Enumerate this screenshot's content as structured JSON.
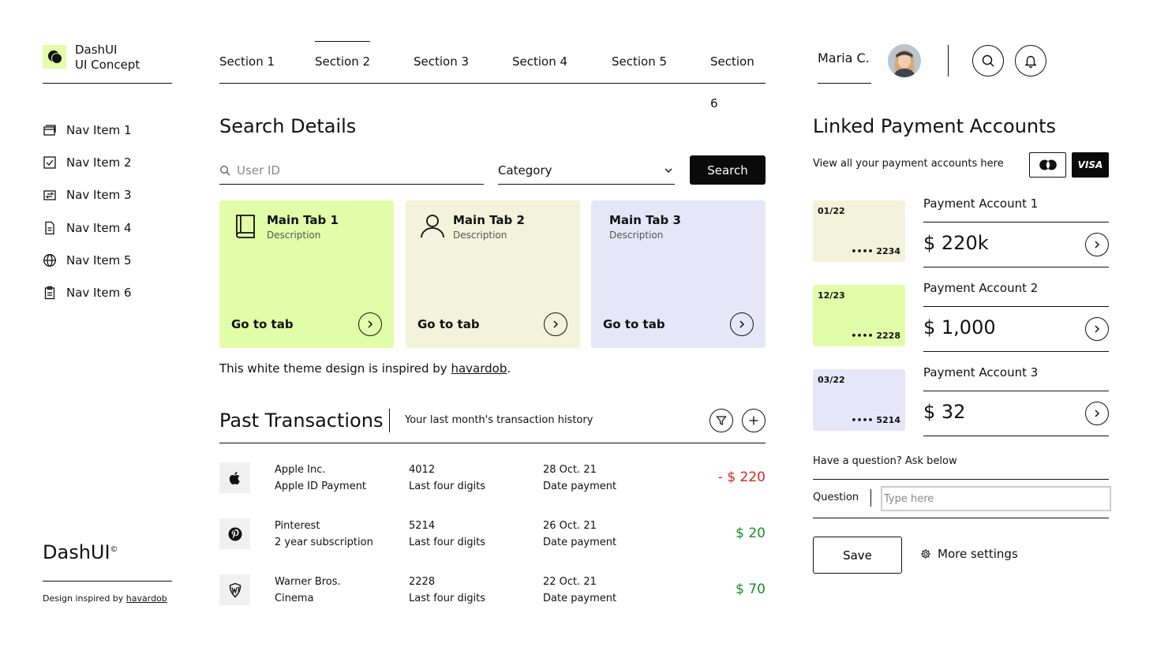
{
  "brand": {
    "name_line1": "DashUI",
    "name_line2": "UI Concept"
  },
  "sidebar": {
    "items": [
      {
        "label": "Nav Item 1",
        "icon": "cards-icon"
      },
      {
        "label": "Nav Item 2",
        "icon": "checkbox-icon"
      },
      {
        "label": "Nav Item 3",
        "icon": "transfer-icon"
      },
      {
        "label": "Nav Item 4",
        "icon": "document-icon"
      },
      {
        "label": "Nav Item 5",
        "icon": "globe-icon"
      },
      {
        "label": "Nav Item 6",
        "icon": "clipboard-icon"
      }
    ],
    "footer_logo": "DashUI",
    "footer_logo_mark": "©",
    "footer_note_prefix": "Design inspired by ",
    "footer_note_link": "havardob"
  },
  "tabs": {
    "items": [
      "Section 1",
      "Section 2",
      "Section 3",
      "Section 4",
      "Section 5",
      "Section 6"
    ],
    "active_index": 1
  },
  "user": {
    "name": "Maria C."
  },
  "search": {
    "title": "Search Details",
    "placeholder": "User ID",
    "category_label": "Category",
    "button_label": "Search"
  },
  "cards": [
    {
      "title": "Main Tab 1",
      "description": "Description",
      "action": "Go to tab",
      "icon": "book-icon",
      "color": "#e2fda8"
    },
    {
      "title": "Main Tab 2",
      "description": "Description",
      "action": "Go to tab",
      "icon": "user-icon",
      "color": "#f2f3da"
    },
    {
      "title": "Main Tab 3",
      "description": "Description",
      "action": "Go to tab",
      "icon": "",
      "color": "#e6e6f8"
    }
  ],
  "inspired": {
    "prefix": "This white theme design is inspired by ",
    "link": "havardob",
    "suffix": "."
  },
  "transactions": {
    "title": "Past Transactions",
    "subtitle": "Your last month's transaction history",
    "rows": [
      {
        "logo": "apple-icon",
        "company": "Apple Inc.",
        "detail": "Apple ID Payment",
        "digits": "4012",
        "digits_label": "Last four digits",
        "date": "28 Oct. 21",
        "date_label": "Date payment",
        "amount": "- $ 220",
        "amount_color": "#e0221f"
      },
      {
        "logo": "pinterest-icon",
        "company": "Pinterest",
        "detail": "2 year subscription",
        "digits": "5214",
        "digits_label": "Last four digits",
        "date": "26 Oct. 21",
        "date_label": "Date payment",
        "amount": "$ 20",
        "amount_color": "#1c8a2a"
      },
      {
        "logo": "warner-bros-icon",
        "company": "Warner Bros.",
        "detail": "Cinema",
        "digits": "2228",
        "digits_label": "Last four digits",
        "date": "22 Oct. 21",
        "date_label": "Date payment",
        "amount": "$ 70",
        "amount_color": "#1c8a2a"
      }
    ]
  },
  "payments": {
    "title": "Linked Payment Accounts",
    "subtitle": "View all your payment accounts here",
    "visa_label": "VISA",
    "accounts": [
      {
        "name": "Payment Account 1",
        "amount": "$ 220k",
        "card_date": "01/22",
        "card_number": "•••• 2234",
        "card_color": "#f2f3da"
      },
      {
        "name": "Payment Account 2",
        "amount": "$ 1,000",
        "card_date": "12/23",
        "card_number": "•••• 2228",
        "card_color": "#e2fda8"
      },
      {
        "name": "Payment Account 3",
        "amount": "$ 32",
        "card_date": "03/22",
        "card_number": "•••• 5214",
        "card_color": "#e6e6f8"
      }
    ],
    "question_prompt": "Have a question? Ask below",
    "question_label": "Question",
    "question_placeholder": "Type here",
    "save_label": "Save",
    "more_settings_label": "More settings"
  }
}
